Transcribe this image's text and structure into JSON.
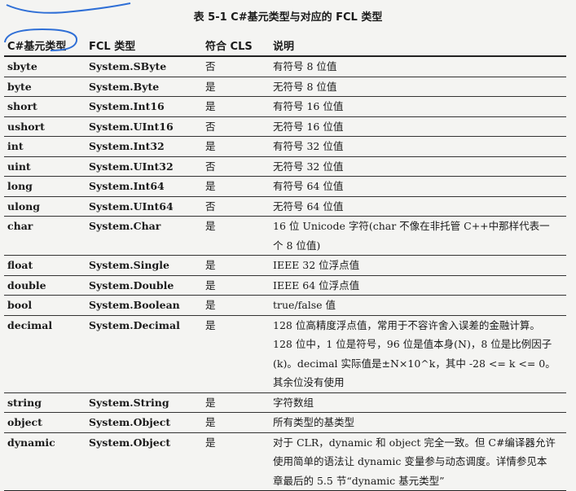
{
  "title": "表 5-1   C#基元类型与对应的 FCL 类型",
  "headers": [
    "C#基元类型",
    "FCL 类型",
    "符合 CLS",
    "说明"
  ],
  "rows": [
    {
      "cs": "sbyte",
      "fcl": "System.SByte",
      "cls": "否",
      "desc": "有符号 8 位值"
    },
    {
      "cs": "byte",
      "fcl": "System.Byte",
      "cls": "是",
      "desc": "无符号 8 位值"
    },
    {
      "cs": "short",
      "fcl": "System.Int16",
      "cls": "是",
      "desc": "有符号 16 位值"
    },
    {
      "cs": "ushort",
      "fcl": "System.UInt16",
      "cls": "否",
      "desc": "无符号 16 位值"
    },
    {
      "cs": "int",
      "fcl": "System.Int32",
      "cls": "是",
      "desc": "有符号 32 位值"
    },
    {
      "cs": "uint",
      "fcl": "System.UInt32",
      "cls": "否",
      "desc": "无符号 32 位值"
    },
    {
      "cs": "long",
      "fcl": "System.Int64",
      "cls": "是",
      "desc": "有符号 64 位值"
    },
    {
      "cs": "ulong",
      "fcl": "System.UInt64",
      "cls": "否",
      "desc": "无符号 64 位值"
    },
    {
      "cs": "char",
      "fcl": "System.Char",
      "cls": "是",
      "desc": "16 位 Unicode 字符(char 不像在非托管 C++中那样代表一个 8 位值)"
    },
    {
      "cs": "float",
      "fcl": "System.Single",
      "cls": "是",
      "desc": "IEEE 32 位浮点值"
    },
    {
      "cs": "double",
      "fcl": "System.Double",
      "cls": "是",
      "desc": "IEEE 64 位浮点值"
    },
    {
      "cs": "bool",
      "fcl": "System.Boolean",
      "cls": "是",
      "desc": "true/false 值"
    },
    {
      "cs": "decimal",
      "fcl": "System.Decimal",
      "cls": "是",
      "desc": "128 位高精度浮点值，常用于不容许舍入误差的金融计算。128 位中，1 位是符号，96 位是值本身(N)，8 位是比例因子(k)。decimal 实际值是±N×10^k，其中 -28 <= k <= 0。其余位没有使用"
    },
    {
      "cs": "string",
      "fcl": "System.String",
      "cls": "是",
      "desc": "字符数组"
    },
    {
      "cs": "object",
      "fcl": "System.Object",
      "cls": "是",
      "desc": "所有类型的基类型"
    },
    {
      "cs": "dynamic",
      "fcl": "System.Object",
      "cls": "是",
      "desc": "对于 CLR，dynamic 和 object 完全一致。但 C#编译器允许使用简单的语法让 dynamic 变量参与动态调度。详情参见本章最后的 5.5 节“dynamic 基元类型”"
    }
  ],
  "colors": {
    "annotation": "#2f6fd6",
    "rule": "#222222"
  }
}
